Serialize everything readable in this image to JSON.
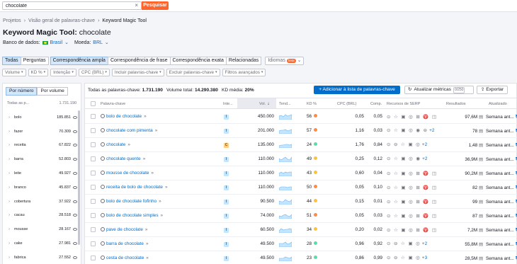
{
  "search": {
    "value": "chocolate",
    "button": "Pesquisar"
  },
  "breadcrumb": [
    "Projetos",
    "Visão geral de palavras-chave",
    "Keyword Magic Tool"
  ],
  "title": {
    "main": "Keyword Magic Tool:",
    "keyword": "chocolate"
  },
  "database": {
    "label": "Banco de dados:",
    "country": "Brasil",
    "currency_label": "Moeda:",
    "currency": "BRL"
  },
  "match_tabs": [
    "Todas",
    "Perguntas"
  ],
  "type_tabs": [
    "Correspondência ampla",
    "Correspondência de frase",
    "Correspondência exata",
    "Relacionadas"
  ],
  "languages": {
    "label": "Idiomas",
    "badge": "beta"
  },
  "filters": [
    "Volume",
    "KD %",
    "Intenção",
    "CPC (BRL)",
    "Incluir palavras-chave",
    "Excluir palavras-chave",
    "Filtros avançados"
  ],
  "group_toggle": [
    "Por número",
    "Por volume"
  ],
  "left_panel": {
    "header_label": "Todas as p...",
    "header_count": "1.731.190",
    "items": [
      {
        "word": "bolo",
        "count": "185.851"
      },
      {
        "word": "fazer",
        "count": "70.309"
      },
      {
        "word": "receita",
        "count": "67.822"
      },
      {
        "word": "barra",
        "count": "52.803"
      },
      {
        "word": "leite",
        "count": "49.927"
      },
      {
        "word": "branco",
        "count": "45.837"
      },
      {
        "word": "cobertura",
        "count": "37.922"
      },
      {
        "word": "cacau",
        "count": "28.518"
      },
      {
        "word": "mousse",
        "count": "28.167"
      },
      {
        "word": "cake",
        "count": "27.981"
      },
      {
        "word": "fabrica",
        "count": "27.552"
      }
    ]
  },
  "summary": {
    "total_label": "Todas as palavras-chave:",
    "total": "1.731.190",
    "volume_label": "Volume total:",
    "volume": "14.290.380",
    "kd_label": "KD média:",
    "kd": "20%"
  },
  "buttons": {
    "add": "Adicionar à lista de palavras-chave",
    "update": "Atualizar métricas",
    "update_count": "0/250",
    "export": "Exportar"
  },
  "columns": [
    "Palavra-chave",
    "Inte...",
    "Vol.",
    "Tend...",
    "KD %",
    "CPC (BRL)",
    "Comp.",
    "Recursos de SERP",
    "Resultados",
    "Atualizado"
  ],
  "rows": [
    {
      "keyword": "bolo de chocolate",
      "intent": "I",
      "volume": "450.000",
      "kd": "56",
      "kd_color": "#ff8c43",
      "cpc": "0,05",
      "comp": "0,05",
      "serp": "⊙ ☆ ▣ ◎ ⊞ ♈ ◫",
      "serp_more": "",
      "results": "97,6M",
      "updated": "Semana ant..."
    },
    {
      "keyword": "chocolate com pimenta",
      "intent": "I",
      "volume": "201.000",
      "kd": "57",
      "kd_color": "#ff8c43",
      "cpc": "1,16",
      "comp": "0,03",
      "serp": "⊙ ☆ ▣ ◎ ◉ ⊜",
      "serp_more": "+2",
      "results": "78",
      "updated": "Semana ant..."
    },
    {
      "keyword": "chocolate",
      "intent": "C",
      "volume": "135.000",
      "kd": "24",
      "kd_color": "#59ddaa",
      "cpc": "1,76",
      "comp": "0,84",
      "serp": "⊙ ⊖ ☆ ▣ ◎",
      "serp_more": "+2",
      "results": "1,48",
      "updated": "Semana ant..."
    },
    {
      "keyword": "chocolate quente",
      "intent": "I",
      "volume": "110.000",
      "kd": "49",
      "kd_color": "#fdc23c",
      "cpc": "0,25",
      "comp": "0,12",
      "serp": "⊙ ☆ ▣ ◎ ◉",
      "serp_more": "+2",
      "results": "36,9M",
      "updated": "Semana ant..."
    },
    {
      "keyword": "mousse de chocolate",
      "intent": "I",
      "volume": "110.000",
      "kd": "43",
      "kd_color": "#fdc23c",
      "cpc": "0,60",
      "comp": "0,04",
      "serp": "⊙ ☆ ▣ ◎ ⊞ ♈ ◫",
      "serp_more": "",
      "results": "90,2M",
      "updated": "Semana ant..."
    },
    {
      "keyword": "receita de bolo de chocolate",
      "intent": "I",
      "volume": "110.000",
      "kd": "50",
      "kd_color": "#ff8c43",
      "cpc": "0,05",
      "comp": "0,10",
      "serp": "⊙ ☆ ▣ ◎ ⊞ ♈ ◫",
      "serp_more": "",
      "results": "82",
      "updated": "Semana ant..."
    },
    {
      "keyword": "bolo de chocolate fofinho",
      "intent": "I",
      "volume": "90.500",
      "kd": "44",
      "kd_color": "#fdc23c",
      "cpc": "0,15",
      "comp": "0,01",
      "serp": "⊙ ☆ ▣ ◎ ⊞ ♈ ◫",
      "serp_more": "",
      "results": "99",
      "updated": "Semana ant..."
    },
    {
      "keyword": "bolo de chocolate simples",
      "intent": "I",
      "volume": "74.000",
      "kd": "51",
      "kd_color": "#ff8c43",
      "cpc": "0,05",
      "comp": "0,03",
      "serp": "⊙ ☆ ▣ ◎ ⊞ ♈ ◫",
      "serp_more": "",
      "results": "87",
      "updated": "Semana ant..."
    },
    {
      "keyword": "pave de chocolate",
      "intent": "I",
      "volume": "60.500",
      "kd": "34",
      "kd_color": "#fdc23c",
      "cpc": "0,20",
      "comp": "0,02",
      "serp": "⊙ ☆ ▣ ◎ ⊞ ♈ ◫",
      "serp_more": "",
      "results": "7,2M",
      "updated": "Semana ant..."
    },
    {
      "keyword": "barra de chocolate",
      "intent": "I",
      "volume": "49.500",
      "kd": "28",
      "kd_color": "#59ddaa",
      "cpc": "0,96",
      "comp": "0,92",
      "serp": "⊙ ⊖ ☆ ▣ ◎",
      "serp_more": "+2",
      "results": "55,8M",
      "updated": "Semana ant..."
    },
    {
      "keyword": "cesta de chocolate",
      "intent": "I",
      "volume": "49.500",
      "kd": "23",
      "kd_color": "#59ddaa",
      "cpc": "0,86",
      "comp": "0,99",
      "serp": "⊙ ⊖ ☆ ▣ ◎",
      "serp_more": "+3",
      "results": "28,5M",
      "updated": "Semana ant..."
    }
  ]
}
